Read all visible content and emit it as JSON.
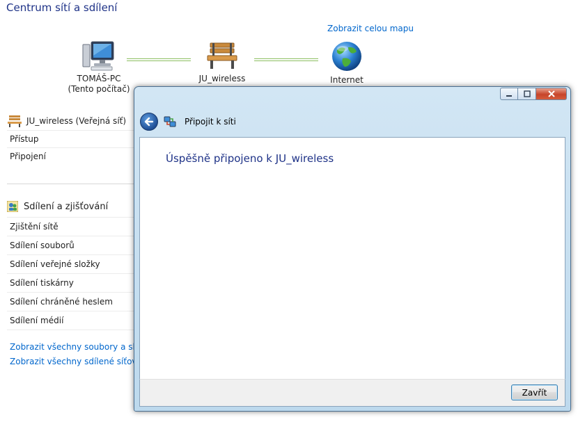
{
  "page": {
    "title": "Centrum sítí a sdílení",
    "map_link": "Zobrazit celou mapu"
  },
  "network_map": {
    "computer": {
      "name": "TOMÁŠ-PC",
      "subtitle": "(Tento počítač)",
      "icon": "computer-icon"
    },
    "network": {
      "name": "JU_wireless",
      "icon": "bench-icon"
    },
    "internet": {
      "name": "Internet",
      "icon": "globe-icon"
    }
  },
  "network_details": {
    "header": "JU_wireless (Veřejná síť)",
    "rows": [
      "Přístup",
      "Připojení"
    ]
  },
  "sharing": {
    "header": "Sdílení a zjišťování",
    "items": [
      "Zjištění sítě",
      "Sdílení souborů",
      "Sdílení veřejné složky",
      "Sdílení tiskárny",
      "Sdílení chráněné heslem",
      "Sdílení médií"
    ]
  },
  "bottom_links": [
    "Zobrazit všechny soubory a složky",
    "Zobrazit všechny sdílené síťové sl"
  ],
  "dialog": {
    "title": "Připojit k síti",
    "message": "Úspěšně připojeno k JU_wireless",
    "close_button": "Zavřít",
    "window_controls": {
      "minimize": "minimize-icon",
      "maximize": "maximize-icon",
      "close": "close-icon"
    }
  },
  "colors": {
    "heading": "#1e3287",
    "link": "#0066cc",
    "connection_line": "#8cbf60"
  }
}
